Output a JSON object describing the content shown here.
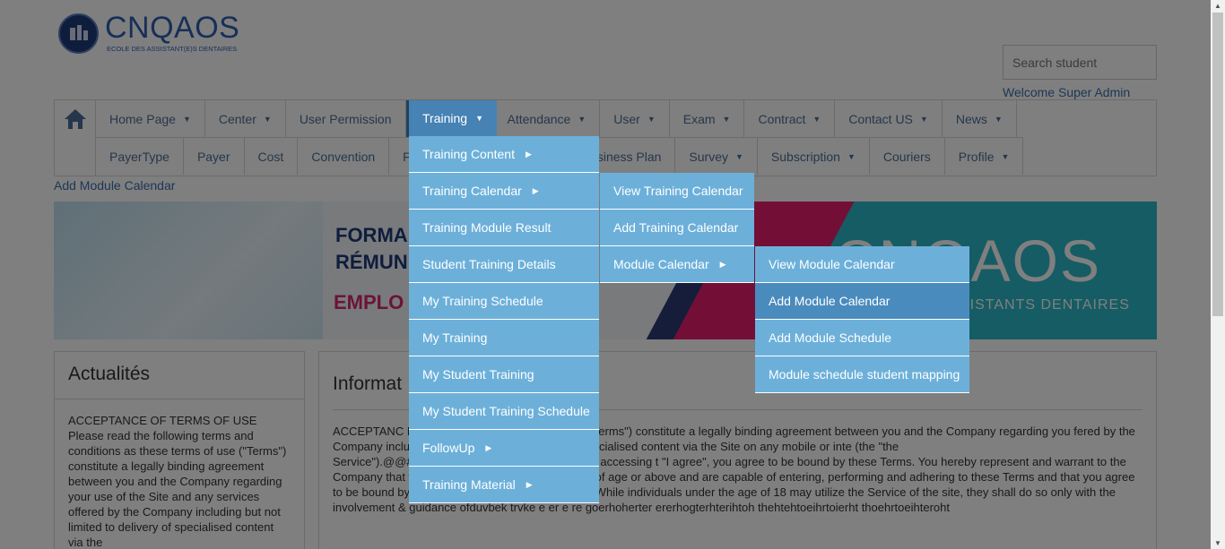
{
  "logo": {
    "name": "CNQAOS",
    "tagline": "ECOLE DES ASSISTANT(E)S DENTAIRES"
  },
  "search": {
    "placeholder": "Search student"
  },
  "welcome": "Welcome Super Admin",
  "nav": {
    "row1": [
      {
        "label": "Home Page",
        "caret": true
      },
      {
        "label": "Center",
        "caret": true
      },
      {
        "label": "User Permission",
        "caret": false
      },
      {
        "label": "Training",
        "caret": true,
        "active": true
      },
      {
        "label": "Attendance",
        "caret": true
      },
      {
        "label": "User",
        "caret": true
      },
      {
        "label": "Exam",
        "caret": true
      },
      {
        "label": "Contract",
        "caret": true
      },
      {
        "label": "Contact US",
        "caret": true
      },
      {
        "label": "News",
        "caret": true
      }
    ],
    "row2": [
      {
        "label": "PayerType",
        "caret": false
      },
      {
        "label": "Payer",
        "caret": false
      },
      {
        "label": "Cost",
        "caret": false
      },
      {
        "label": "Convention",
        "caret": false
      },
      {
        "label": "F",
        "caret": false
      },
      {
        "label": "",
        "caret": false
      },
      {
        "label": "Business Plan",
        "caret": false
      },
      {
        "label": "Survey",
        "caret": true
      },
      {
        "label": "Subscription",
        "caret": true
      },
      {
        "label": "Couriers",
        "caret": false
      },
      {
        "label": "Profile",
        "caret": true
      }
    ]
  },
  "breadcrumb": "Add Module Calendar",
  "banner": {
    "line1": "FORMA",
    "line2": "RÉMUN",
    "line3": "EMPLO",
    "brand": "CNQAOS",
    "brand_sub": "SISTANTS DENTAIRES"
  },
  "left_panel": {
    "title": "Actualités",
    "body": "ACCEPTANCE OF TERMS OF USE Please read the following terms and conditions as these terms of use (\"Terms\") constitute a legally binding agreement between you and the Company regarding your use of the Site and any services offered by the Company including but not limited to delivery of specialised content via the"
  },
  "right_panel": {
    "title": "Informat",
    "body": "ACCEPTANC\nPlease read th                                                    these terms of use (\"Terms\") constitute a legally binding agreement between you and the Company regarding you                                               fered by the Company including but not limited to delivery of specialised content via the Site on any mobile or inte                                              (the \"the Service\").@@#$&%^%^&%$%^$%#$@^%#$% By accessing t                                                  \"I agree\", you agree to be bound by these Terms. You hereby represent and warrant to the Company that you are at least eighteen (18) years of age or above and are capable of entering, performing and adhering to these Terms and that you agree to be bound by the following terms and conditions. While individuals under the age of 18 may utilize the Service of the site, they shall do so only with the involvement & guidance ofduvbek     trvke e er e  re goerhoherter  ererhogterhterihtoh   thehtehtoeihrtoierht  thoehrtoeihteroht"
  },
  "training_menu": {
    "top_label": "Training",
    "items": [
      {
        "label": "Training Content",
        "sub": true
      },
      {
        "label": "Training Calendar",
        "sub": true
      },
      {
        "label": "Training Module Result",
        "sub": false
      },
      {
        "label": "Student Training Details",
        "sub": false
      },
      {
        "label": "My Training Schedule",
        "sub": false
      },
      {
        "label": "My Training",
        "sub": false
      },
      {
        "label": "My Student Training",
        "sub": false
      },
      {
        "label": "My Student Training Schedule",
        "sub": false
      },
      {
        "label": "FollowUp",
        "sub": true
      },
      {
        "label": "Training Material",
        "sub": true
      }
    ]
  },
  "calendar_menu": {
    "items": [
      {
        "label": "View Training Calendar",
        "sub": false
      },
      {
        "label": "Add Training Calendar",
        "sub": false
      },
      {
        "label": "Module Calendar",
        "sub": true
      }
    ]
  },
  "module_menu": {
    "items": [
      {
        "label": "View Module Calendar",
        "highlight": false
      },
      {
        "label": "Add Module Calendar",
        "highlight": true
      },
      {
        "label": "Add Module Schedule",
        "highlight": false
      },
      {
        "label": "Module schedule student mapping",
        "highlight": false
      }
    ]
  },
  "colors": {
    "menu_bg": "#6cb0da",
    "menu_highlight": "#4a8bbd",
    "active_tab": "#4682b4",
    "link": "#3a6fae"
  }
}
